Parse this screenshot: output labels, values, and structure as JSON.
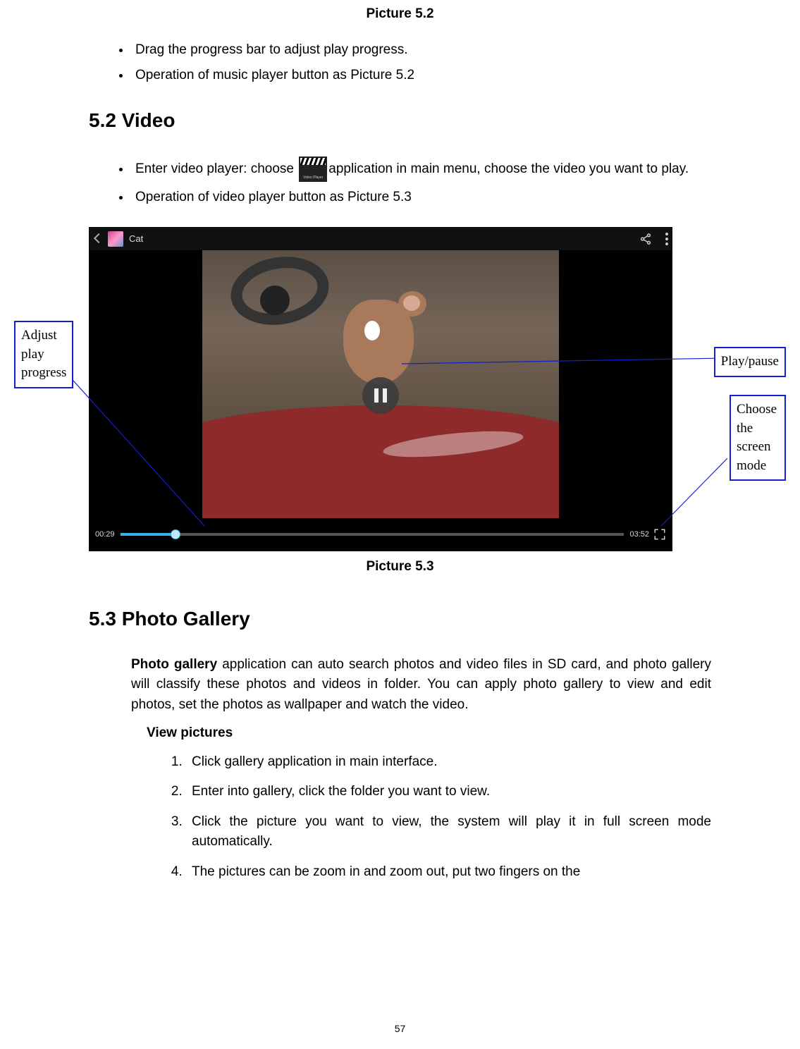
{
  "caption52": "Picture 5.2",
  "bulletsA": [
    "Drag the progress bar to adjust play progress.",
    "Operation of music player button as Picture 5.2"
  ],
  "heading52": "5.2 Video",
  "videoBullet1a": "Enter video player: choose ",
  "videoBullet1b": "application in main menu, choose the video you want to play.",
  "videoBullet2": "Operation of video player button as Picture 5.3",
  "videoIconLabel": "Video Player",
  "screenshot": {
    "title": "Cat",
    "elapsed": "00:29",
    "duration": "03:52"
  },
  "caption53": "Picture 5.3",
  "callouts": {
    "progress": "Adjust play progress",
    "playpause": "Play/pause",
    "screenmode": "Choose the screen mode"
  },
  "heading53": "5.3 Photo Gallery",
  "galleryLead": "Photo gallery",
  "galleryBody": " application can auto search photos and video files in SD card, and photo gallery will classify these photos and videos in folder. You can apply photo gallery to view and edit photos, set the photos as wallpaper and watch the video.",
  "viewPictures": "View pictures",
  "steps": [
    "Click gallery application in main interface.",
    "Enter into gallery, click the folder you want to view.",
    "Click the picture you want to view, the system will play it in full screen mode automatically.",
    "The pictures can be zoom in and zoom out, put two fingers on the"
  ],
  "pageNumber": "57"
}
